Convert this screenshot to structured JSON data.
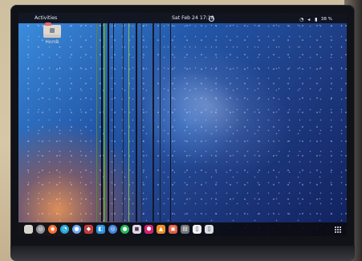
{
  "topbar": {
    "activities": "Activities",
    "clock": "Sat Feb 24  17:18",
    "battery": "38 %"
  },
  "desktop": {
    "home_label": "Home"
  },
  "icons": {
    "folder": "folder-icon",
    "wifi": "wifi-icon",
    "speaker": "speaker-icon",
    "battery": "battery-icon",
    "grid": "app-grid-icon"
  },
  "dock": {
    "apps": [
      {
        "name": "files-icon",
        "color": "#d8d5cf",
        "symbol": ""
      },
      {
        "name": "disc-icon",
        "color": "#8c8f96",
        "symbol": "◎"
      },
      {
        "name": "firefox-icon",
        "color": "#f46c2c",
        "symbol": "◉"
      },
      {
        "name": "edge-icon",
        "color": "#1aa3d8",
        "symbol": "◔"
      },
      {
        "name": "messages-icon",
        "color": "#6aa7ff",
        "symbol": "●"
      },
      {
        "name": "shield-icon",
        "color": "#c13a3a",
        "symbol": "◆"
      },
      {
        "name": "code-icon",
        "color": "#1e8fe1",
        "symbol": "◧"
      },
      {
        "name": "browser-icon",
        "color": "#3f81db",
        "symbol": "◎"
      },
      {
        "name": "spotify-icon",
        "color": "#1db954",
        "symbol": "●"
      },
      {
        "name": "photos-icon",
        "color": "#e6d5ea",
        "symbol": "◼"
      },
      {
        "name": "ruby-icon",
        "color": "#d61d67",
        "symbol": "⬢"
      },
      {
        "name": "vlc-icon",
        "color": "#f28c1c",
        "symbol": "▲"
      },
      {
        "name": "image-viewer-icon",
        "color": "#e05a3c",
        "symbol": "▣"
      },
      {
        "name": "terminal-icon",
        "color": "#6f7377",
        "symbol": "▤"
      },
      {
        "name": "document-icon",
        "color": "#eef0f3",
        "symbol": "▯"
      },
      {
        "name": "archive-icon",
        "color": "#dadde1",
        "symbol": "▯"
      }
    ]
  }
}
